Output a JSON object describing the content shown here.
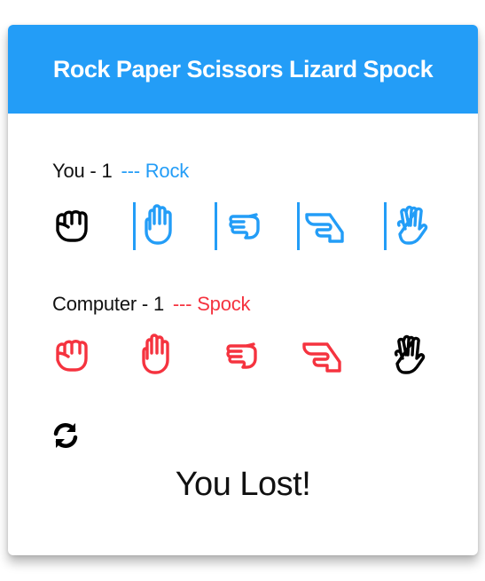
{
  "header": {
    "title": "Rock Paper Scissors Lizard Spock"
  },
  "player": {
    "label": "You - 1",
    "choice_text": "--- Rock",
    "accent": "#239df7"
  },
  "computer": {
    "label": "Computer - 1",
    "choice_text": "--- Spock",
    "accent": "#f5333f"
  },
  "selected_color": "#000000",
  "hands": [
    {
      "name": "rock",
      "icon": "hand-rock-icon"
    },
    {
      "name": "paper",
      "icon": "hand-paper-icon"
    },
    {
      "name": "scissors",
      "icon": "hand-scissors-icon"
    },
    {
      "name": "lizard",
      "icon": "hand-lizard-icon"
    },
    {
      "name": "spock",
      "icon": "hand-spock-icon"
    }
  ],
  "player_selected": "rock",
  "computer_selected": "spock",
  "refresh_icon": "refresh-icon",
  "result": {
    "text": "You Lost!"
  }
}
